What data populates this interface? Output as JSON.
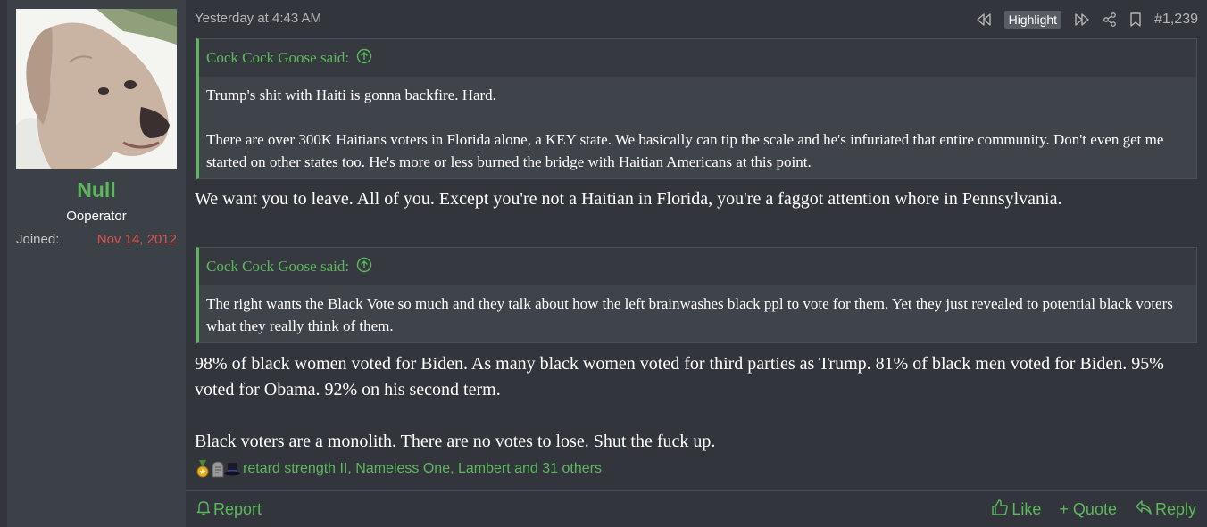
{
  "user": {
    "name": "Null",
    "title": "Ooperator",
    "joined_label": "Joined:",
    "joined_value": "Nov 14, 2012"
  },
  "post": {
    "date": "Yesterday at 4:43 AM",
    "highlight_label": "Highlight",
    "number": "#1,239",
    "quotes": [
      {
        "author": "Cock Cock Goose said:",
        "lines": [
          "Trump's shit with Haiti is gonna backfire. Hard.",
          "There are over 300K Haitians voters in Florida alone, a KEY state. We basically can tip the scale and he's infuriated that entire community. Don't even get me started on other states too. He's more or less burned the bridge with Haitian Americans at this point."
        ]
      },
      {
        "author": "Cock Cock Goose said:",
        "lines": [
          "The right wants the Black Vote so much and they talk about how the left brainwashes black ppl to vote for them. Yet they just revealed to potential black voters what they really think of them."
        ]
      }
    ],
    "replies": [
      "We want you to leave. All of you. Except you're not a Haitian in Florida, you're a faggot attention whore in Pennsylvania.",
      "98% of black women voted for Biden. As many black women voted for third parties as Trump. 81% of black men voted for Biden. 95% voted for Obama. 92% on his second term.",
      "Black voters are a monolith. There are no votes to lose. Shut the fuck up."
    ],
    "reactions_text": "retard strength II, Nameless One, Lambert and 31 others"
  },
  "footer": {
    "report": "Report",
    "like": "Like",
    "quote": "+ Quote",
    "reply": "Reply"
  },
  "colors": {
    "accent": "#5cb85c",
    "joined_date": "#d9534f",
    "background": "#32353b",
    "panel": "#3c4047"
  }
}
